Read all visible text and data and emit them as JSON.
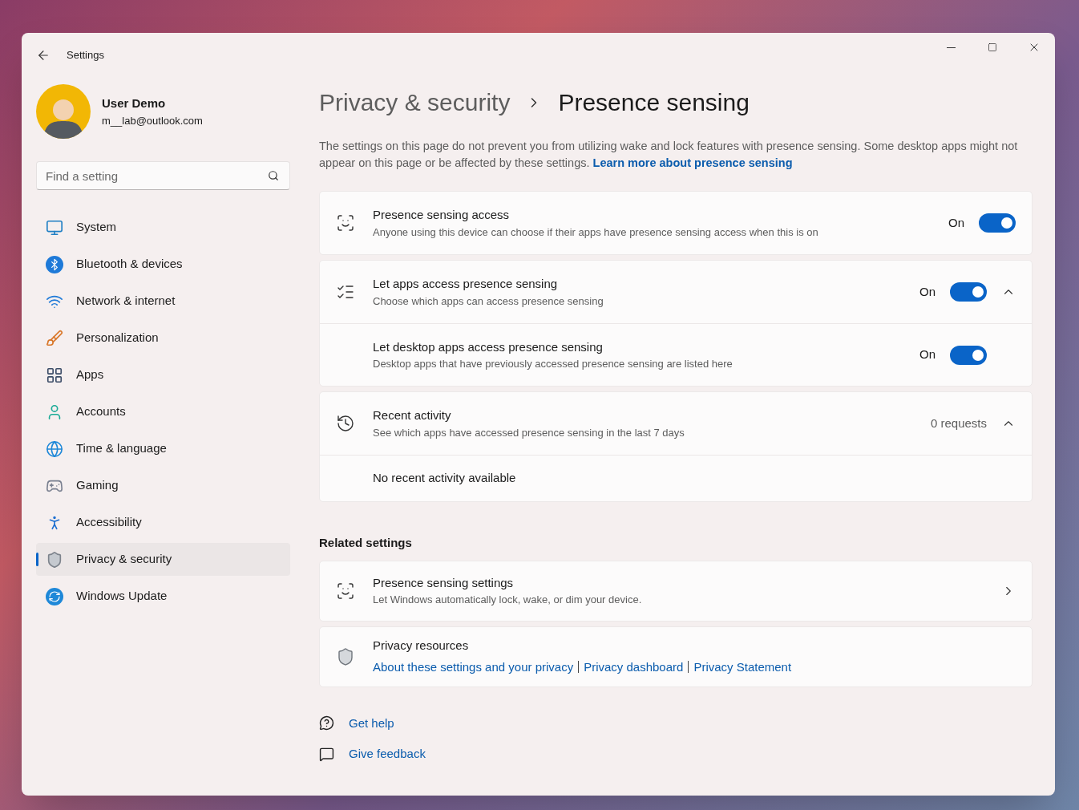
{
  "window": {
    "title": "Settings"
  },
  "user": {
    "name": "User Demo",
    "email": "m__lab@outlook.com"
  },
  "search": {
    "placeholder": "Find a setting"
  },
  "nav": [
    {
      "label": "System",
      "selected": false
    },
    {
      "label": "Bluetooth & devices",
      "selected": false
    },
    {
      "label": "Network & internet",
      "selected": false
    },
    {
      "label": "Personalization",
      "selected": false
    },
    {
      "label": "Apps",
      "selected": false
    },
    {
      "label": "Accounts",
      "selected": false
    },
    {
      "label": "Time & language",
      "selected": false
    },
    {
      "label": "Gaming",
      "selected": false
    },
    {
      "label": "Accessibility",
      "selected": false
    },
    {
      "label": "Privacy & security",
      "selected": true
    },
    {
      "label": "Windows Update",
      "selected": false
    }
  ],
  "breadcrumb": {
    "parent": "Privacy & security",
    "current": "Presence sensing"
  },
  "description": {
    "text": "The settings on this page do not prevent you from utilizing wake and lock features with presence sensing. Some desktop apps might not appear on this page or be affected by these settings.",
    "link": "Learn more about presence sensing"
  },
  "groups": [
    {
      "rows": [
        {
          "kind": "toggle",
          "title": "Presence sensing access",
          "subtitle": "Anyone using this device can choose if their apps have presence sensing access when this is on",
          "state_label": "On",
          "on": true
        }
      ]
    },
    {
      "rows": [
        {
          "kind": "toggle",
          "title": "Let apps access presence sensing",
          "subtitle": "Choose which apps can access presence sensing",
          "state_label": "On",
          "on": true,
          "expanded": true
        },
        {
          "kind": "toggle",
          "title": "Let desktop apps access presence sensing",
          "subtitle": "Desktop apps that have previously accessed presence sensing are listed here",
          "state_label": "On",
          "on": true
        }
      ]
    },
    {
      "rows": [
        {
          "kind": "count",
          "title": "Recent activity",
          "subtitle": "See which apps have accessed presence sensing in the last 7 days",
          "value": "0 requests",
          "expanded": true
        },
        {
          "kind": "message",
          "title": "No recent activity available"
        }
      ]
    }
  ],
  "related": {
    "title": "Related settings",
    "items": [
      {
        "kind": "link_row",
        "title": "Presence sensing settings",
        "subtitle": "Let Windows automatically lock, wake, or dim your device."
      },
      {
        "kind": "resources",
        "title": "Privacy resources",
        "links": [
          "About these settings and your privacy",
          "Privacy dashboard",
          "Privacy Statement"
        ]
      }
    ]
  },
  "footer": [
    {
      "label": "Get help"
    },
    {
      "label": "Give feedback"
    }
  ]
}
